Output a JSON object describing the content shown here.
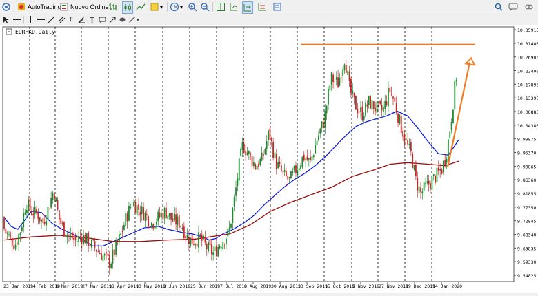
{
  "toolbar": {
    "autotrading_label": "AutoTrading",
    "new_order_label": "Nuovo Ordine"
  },
  "chart": {
    "symbol_label": "EURHKD,Daily",
    "colors": {
      "bull": "#1e8a2e",
      "bear": "#c62828",
      "ma_fast": "#0b1fd6",
      "ma_slow": "#9e0b0b",
      "annotation": "#f07a22",
      "grid": "#000000"
    },
    "y_ticks": [
      "10.35915",
      "10.31400",
      "10.26905",
      "10.22400",
      "10.17895",
      "10.13390",
      "10.08885",
      "10.04380",
      "9.99875",
      "9.95370",
      "9.90865",
      "9.86360",
      "9.81855",
      "9.77350",
      "9.72845",
      "9.68340",
      "9.63835",
      "9.59330",
      "9.54825"
    ],
    "x_ticks": [
      "23 Jan 2019",
      "14 Feb 2019",
      "8 Mar 2019",
      "27 Mar 2019",
      "18 Apr 2019",
      "10 May 2019",
      "3 Jun 2019",
      "25 Jun 2019",
      "17 Jul 2019",
      "8 Aug 2019",
      "30 Aug 2019",
      "23 Sep 2019",
      "15 Oct 2019",
      "5 Nov 2019",
      "27 Nov 2019",
      "19 Dec 2019",
      "14 Jan 2020"
    ]
  },
  "chart_data": {
    "type": "candlestick",
    "title": "EURHKD,Daily",
    "ylim": [
      9.54825,
      10.35915
    ],
    "series": [
      {
        "name": "price",
        "x_start": "23 Jan 2019",
        "x_end": "31 Jan 2020",
        "y_start": 9.74,
        "y_end": 10.265,
        "y_max": 10.31,
        "y_min": 9.575
      },
      {
        "name": "ma_fast",
        "points": [
          [
            0,
            9.74
          ],
          [
            10,
            9.71
          ],
          [
            20,
            9.7
          ],
          [
            30,
            9.73
          ],
          [
            40,
            9.76
          ],
          [
            55,
            9.755
          ],
          [
            70,
            9.72
          ],
          [
            85,
            9.7
          ],
          [
            100,
            9.685
          ],
          [
            115,
            9.665
          ],
          [
            130,
            9.645
          ],
          [
            145,
            9.645
          ],
          [
            165,
            9.665
          ],
          [
            185,
            9.685
          ],
          [
            205,
            9.705
          ],
          [
            225,
            9.71
          ],
          [
            240,
            9.7
          ],
          [
            260,
            9.69
          ],
          [
            275,
            9.685
          ],
          [
            290,
            9.675
          ],
          [
            300,
            9.665
          ],
          [
            310,
            9.67
          ],
          [
            320,
            9.685
          ],
          [
            335,
            9.7
          ],
          [
            350,
            9.72
          ],
          [
            365,
            9.745
          ],
          [
            380,
            9.78
          ],
          [
            395,
            9.81
          ],
          [
            410,
            9.84
          ],
          [
            425,
            9.865
          ],
          [
            440,
            9.885
          ],
          [
            455,
            9.91
          ],
          [
            470,
            9.94
          ],
          [
            485,
            9.975
          ],
          [
            500,
            10.01
          ],
          [
            515,
            10.04
          ],
          [
            530,
            10.055
          ],
          [
            545,
            10.065
          ],
          [
            560,
            10.075
          ],
          [
            575,
            10.09
          ],
          [
            590,
            10.075
          ],
          [
            605,
            10.035
          ],
          [
            620,
            9.99
          ],
          [
            635,
            9.95
          ],
          [
            650,
            9.945
          ],
          [
            665,
            9.995
          ]
        ]
      },
      {
        "name": "ma_slow",
        "points": [
          [
            0,
            9.665
          ],
          [
            40,
            9.675
          ],
          [
            80,
            9.68
          ],
          [
            120,
            9.672
          ],
          [
            160,
            9.66
          ],
          [
            200,
            9.66
          ],
          [
            240,
            9.665
          ],
          [
            280,
            9.668
          ],
          [
            330,
            9.685
          ],
          [
            360,
            9.715
          ],
          [
            390,
            9.76
          ],
          [
            420,
            9.79
          ],
          [
            450,
            9.815
          ],
          [
            480,
            9.84
          ],
          [
            510,
            9.875
          ],
          [
            540,
            9.895
          ],
          [
            565,
            9.915
          ],
          [
            590,
            9.92
          ],
          [
            620,
            9.915
          ],
          [
            645,
            9.91
          ],
          [
            665,
            9.925
          ]
        ]
      }
    ],
    "annotations": {
      "resistance_level": 10.31,
      "arrow": {
        "from": "14 Jan 2020",
        "from_value": 9.905,
        "to_value": 10.265
      }
    }
  }
}
